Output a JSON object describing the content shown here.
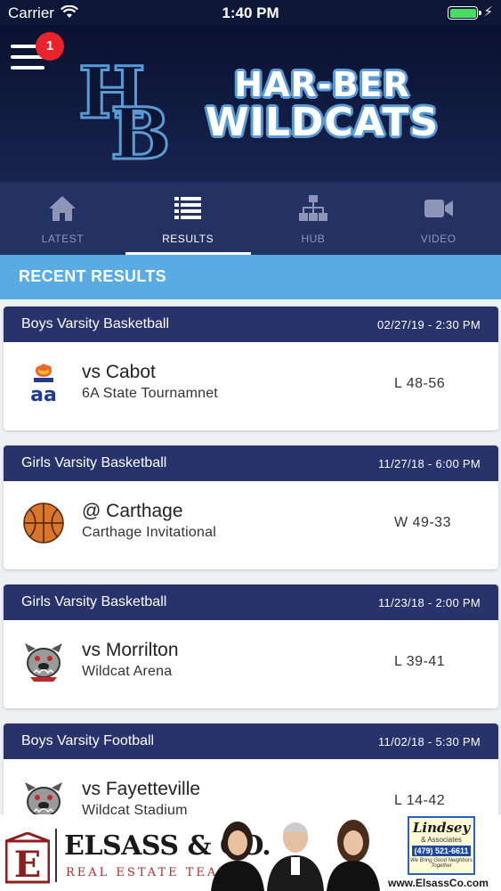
{
  "status_bar": {
    "carrier": "Carrier",
    "time": "1:40 PM"
  },
  "header": {
    "notification_count": "1",
    "logo_line1": "HAR-BER",
    "logo_line2": "WILDCATS",
    "logo_monogram": "HB",
    "colors": {
      "navy": "#0f1738",
      "accent_blue": "#5a9bd5",
      "badge_red": "#e8232b"
    }
  },
  "tabs": [
    {
      "label": "LATEST",
      "icon": "home-icon",
      "active": false
    },
    {
      "label": "RESULTS",
      "icon": "list-icon",
      "active": true
    },
    {
      "label": "HUB",
      "icon": "hierarchy-icon",
      "active": false
    },
    {
      "label": "VIDEO",
      "icon": "video-camera-icon",
      "active": false
    }
  ],
  "section": {
    "title": "RECENT RESULTS",
    "color": "#58ace3"
  },
  "results": [
    {
      "sport": "Boys Varsity Basketball",
      "datetime": "02/27/19 - 2:30 PM",
      "opponent": "vs Cabot",
      "venue": "6A State Tournamnet",
      "score": "L 48-56",
      "logo": "aaa-logo"
    },
    {
      "sport": "Girls Varsity Basketball",
      "datetime": "11/27/18 - 6:00 PM",
      "opponent": "@ Carthage",
      "venue": "Carthage Invitational",
      "score": "W 49-33",
      "logo": "basketball-icon"
    },
    {
      "sport": "Girls Varsity Basketball",
      "datetime": "11/23/18 - 2:00 PM",
      "opponent": "vs Morrilton",
      "venue": "Wildcat Arena",
      "score": "L 39-41",
      "logo": "bulldog-logo"
    },
    {
      "sport": "Boys Varsity Football",
      "datetime": "11/02/18 - 5:30 PM",
      "opponent": "vs Fayetteville",
      "venue": "Wildcat Stadium",
      "score": "L 14-42",
      "logo": "bulldog-logo"
    }
  ],
  "ad": {
    "name": "ELSASS & CO.",
    "tagline": "REAL ESTATE TEAM",
    "partner": "Lindsey",
    "partner_sub": "& Associates",
    "partner_phone": "(479) 521-6611",
    "partner_motto": "We Bring Good Neighbors Together",
    "url": "www.ElsassCo.com"
  }
}
